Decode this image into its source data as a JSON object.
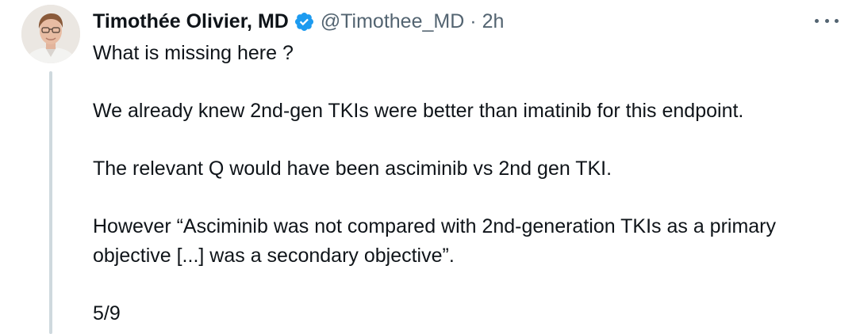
{
  "author": {
    "name": "Timothée Olivier, MD",
    "handle": "@Timothee_MD",
    "separator": "·",
    "time": "2h",
    "verified": true
  },
  "icons": {
    "verified": "verified-badge-icon",
    "more": "more-options-icon"
  },
  "colors": {
    "text": "#0f1419",
    "secondary": "#536471",
    "verified": "#1d9bf0",
    "thread_line": "#cfd9de"
  },
  "tweet": {
    "paragraphs": [
      "What is missing here ?",
      "We already knew 2nd-gen TKIs were better than imatinib for this endpoint.",
      "The relevant Q would have been asciminib vs 2nd gen TKI.",
      "However “Asciminib was not compared with 2nd-generation TKIs as a primary objective [...] was a secondary objective”.",
      "5/9"
    ]
  }
}
